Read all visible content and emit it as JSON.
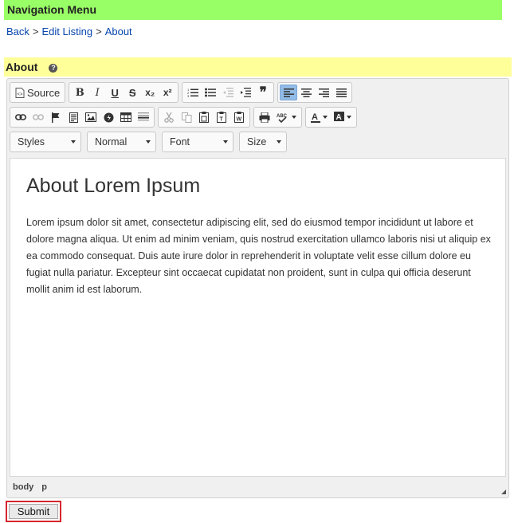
{
  "header": {
    "title": "Navigation Menu"
  },
  "breadcrumb": {
    "back": "Back",
    "sep1": ">",
    "edit_listing": "Edit Listing",
    "sep2": ">",
    "current": "About"
  },
  "section": {
    "title": "About",
    "help_icon": "?"
  },
  "toolbar": {
    "source_label": "Source",
    "bold": "B",
    "italic": "I",
    "underline": "U",
    "strike": "S",
    "subscript": "x₂",
    "superscript": "x²",
    "blockquote": "❞",
    "styles_label": "Styles",
    "format_label": "Normal",
    "font_label": "Font",
    "size_label": "Size"
  },
  "editor": {
    "heading": "About Lorem Ipsum",
    "paragraph": "Lorem ipsum dolor sit amet, consectetur adipiscing elit, sed do eiusmod tempor incididunt ut labore et dolore magna aliqua. Ut enim ad minim veniam, quis nostrud exercitation ullamco laboris nisi ut aliquip ex ea commodo consequat. Duis aute irure dolor in reprehenderit in voluptate velit esse cillum dolore eu fugiat nulla pariatur. Excepteur sint occaecat cupidatat non proident, sunt in culpa qui officia deserunt mollit anim id est laborum.",
    "path": [
      "body",
      "p"
    ]
  },
  "form": {
    "submit_label": "Submit"
  },
  "colors": {
    "header_bg": "#99ff66",
    "section_bg": "#ffff99",
    "link": "#0645ad",
    "active_button": "#92bce7",
    "submit_border": "#d6262c"
  }
}
